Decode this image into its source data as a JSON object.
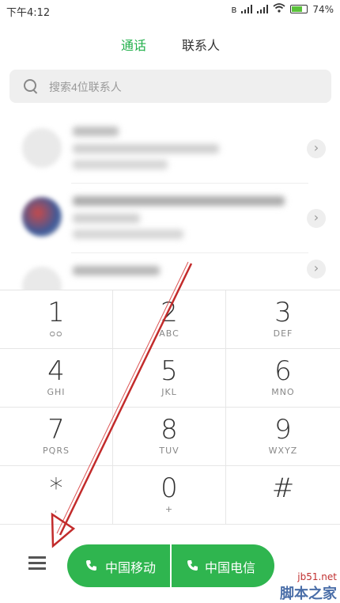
{
  "status_bar": {
    "time": "下午4:12",
    "battery": "74%",
    "battery_level": 0.74
  },
  "tabs": [
    {
      "label": "通话"
    },
    {
      "label": "联系人"
    }
  ],
  "search": {
    "placeholder": "搜索4位联系人"
  },
  "keypad": [
    {
      "digit": "1",
      "letters": "ᴑᴑ"
    },
    {
      "digit": "2",
      "letters": "ABC"
    },
    {
      "digit": "3",
      "letters": "DEF"
    },
    {
      "digit": "4",
      "letters": "GHI"
    },
    {
      "digit": "5",
      "letters": "JKL"
    },
    {
      "digit": "6",
      "letters": "MNO"
    },
    {
      "digit": "7",
      "letters": "PQRS"
    },
    {
      "digit": "8",
      "letters": "TUV"
    },
    {
      "digit": "9",
      "letters": "WXYZ"
    },
    {
      "digit": "*",
      "letters": ","
    },
    {
      "digit": "0",
      "letters": "+"
    },
    {
      "digit": "#",
      "letters": ""
    }
  ],
  "call_buttons": [
    {
      "label": "中国移动",
      "sim": "1"
    },
    {
      "label": "中国电信",
      "sim": "2"
    }
  ],
  "watermark": {
    "line1": "jb51.net",
    "line2": "脚本之家"
  },
  "colors": {
    "accent": "#22b04b",
    "call_button": "#2fb54f",
    "arrow": "#c22b2b"
  },
  "icons": [
    "search-icon",
    "bluetooth-icon",
    "signal-icon",
    "wifi-icon",
    "battery-icon",
    "detail-chevron-icon",
    "menu-icon",
    "phone-icon"
  ]
}
